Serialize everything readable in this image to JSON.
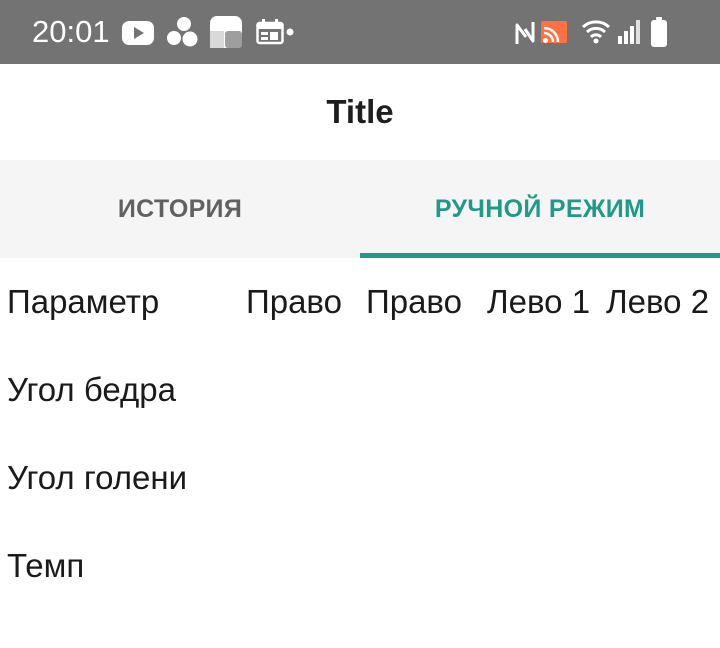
{
  "status_bar": {
    "time": "20:01",
    "left_icons": [
      "youtube-icon",
      "app-dots-icon",
      "widget-icon",
      "calendar-icon",
      "more-dot-icon"
    ],
    "right_icons": [
      "nfc-icon",
      "cast-icon",
      "wifi-icon",
      "signal-icon",
      "battery-icon"
    ],
    "background": "#737373"
  },
  "app_bar": {
    "title": "Title"
  },
  "tabs": {
    "items": [
      {
        "label": "ИСТОРИЯ",
        "selected": false
      },
      {
        "label": "РУЧНОЙ РЕЖИМ",
        "selected": true
      }
    ],
    "accent": "#1f9a86",
    "inactive_color": "#616161"
  },
  "table": {
    "headers": [
      "Параметр",
      "Право",
      "Право",
      "Лево 1",
      "Лево 2"
    ],
    "rows": [
      {
        "label": "Угол бедра"
      },
      {
        "label": "Угол голени"
      },
      {
        "label": "Темп"
      }
    ]
  }
}
